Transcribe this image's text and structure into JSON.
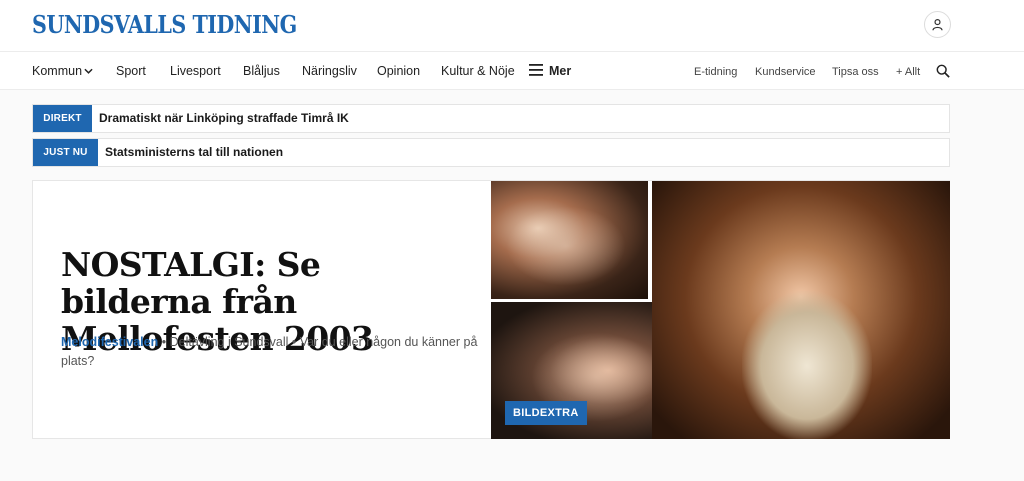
{
  "header": {
    "logo": "SUNDSVALLS TIDNING",
    "user_icon": "user-icon"
  },
  "nav": {
    "items": [
      "Kommun",
      "Sport",
      "Livesport",
      "Blåljus",
      "Näringsliv",
      "Opinion",
      "Kultur & Nöje",
      "Mer"
    ],
    "right_items": [
      "E-tidning",
      "Kundservice",
      "Tipsa oss",
      "+ Allt"
    ],
    "search_icon": "search-icon",
    "menu_icon": "hamburger-icon"
  },
  "tickers": [
    {
      "tag": "DIREKT",
      "text": "Dramatiskt när Linköping straffade Timrå IK"
    },
    {
      "tag": "JUST NU",
      "text": "Statsministerns tal till nationen"
    }
  ],
  "article": {
    "headline": "NOSTALGI: Se bilderna från Mellofesten 2003",
    "category": "Melodifestivalen",
    "meta_1": "Deltävling i Sundsvall",
    "meta_2": "Var du eller någon du känner på plats?",
    "badge": "BILDEXTRA"
  },
  "colors": {
    "brand": "#1f67b0",
    "text": "#1a1a1a"
  }
}
